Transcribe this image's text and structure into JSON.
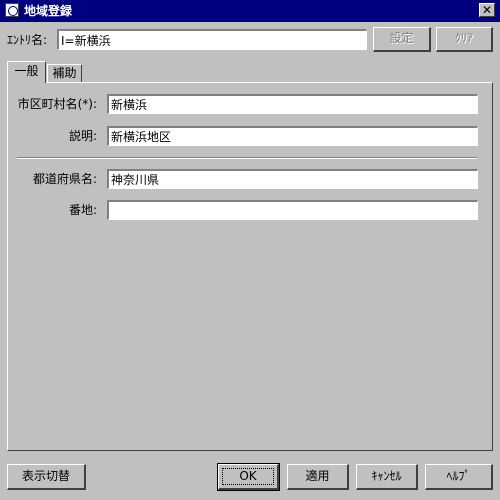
{
  "window": {
    "title": "地域登録",
    "close_glyph": "✕"
  },
  "header": {
    "entry_label": "ｴﾝﾄﾘ名:",
    "entry_value": "I=新横浜",
    "set_button": "設定",
    "clear_button": "ｸﾘｱ"
  },
  "tabs": [
    {
      "label": "一般",
      "selected": true
    },
    {
      "label": "補助",
      "selected": false
    }
  ],
  "general": {
    "city_label": "市区町村名(*):",
    "city_value": "新横浜",
    "desc_label": "説明:",
    "desc_value": "新横浜地区",
    "pref_label": "都道府県名:",
    "pref_value": "神奈川県",
    "address_label": "番地:",
    "address_value": ""
  },
  "footer": {
    "toggle_display": "表示切替",
    "ok": "OK",
    "apply": "適用",
    "cancel": "ｷｬﾝｾﾙ",
    "help": "ﾍﾙﾌﾟ"
  }
}
